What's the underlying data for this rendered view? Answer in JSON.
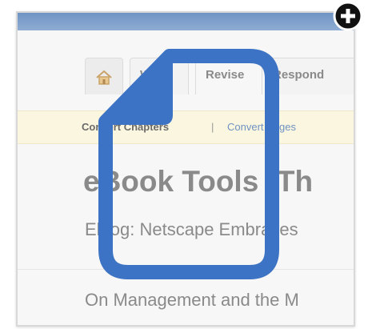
{
  "tabs": [
    {
      "label": ""
    },
    {
      "label": "W"
    },
    {
      "label": "Revise"
    },
    {
      "label": "Respond"
    }
  ],
  "subnav": {
    "current": "Convert Chapters",
    "separator": "|",
    "link": "Convert Pages"
  },
  "page": {
    "heading": "eBook Tools (Th",
    "blog_title": "Eblog: Netscape Embraces",
    "second_title": "On Management and the M"
  },
  "icons": {
    "home": "home-icon",
    "document": "document-icon",
    "add": "add-icon"
  },
  "colors": {
    "accent_blue": "#3d73c4",
    "link_blue": "#6f93c3",
    "subnav_bg": "#fbf6df"
  }
}
